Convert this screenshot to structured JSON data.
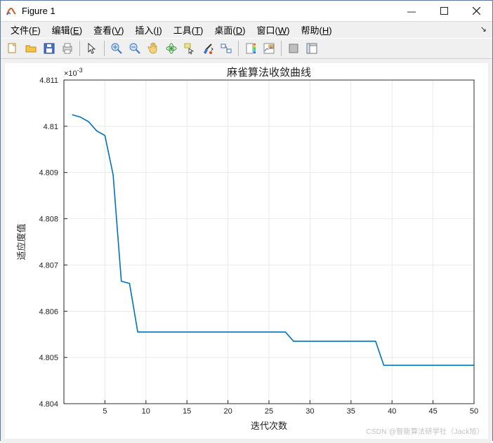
{
  "window": {
    "title": "Figure 1",
    "icon_name": "matlab-figure-icon",
    "buttons": {
      "min": "—",
      "max": "▢",
      "close": "✕"
    }
  },
  "menubar": {
    "items": [
      {
        "label": "文件",
        "mnemonic": "F"
      },
      {
        "label": "编辑",
        "mnemonic": "E"
      },
      {
        "label": "查看",
        "mnemonic": "V"
      },
      {
        "label": "插入",
        "mnemonic": "I"
      },
      {
        "label": "工具",
        "mnemonic": "T"
      },
      {
        "label": "桌面",
        "mnemonic": "D"
      },
      {
        "label": "窗口",
        "mnemonic": "W"
      },
      {
        "label": "帮助",
        "mnemonic": "H"
      }
    ],
    "overflow": "↘"
  },
  "toolbar": {
    "new": "new-figure-icon",
    "open": "open-folder-icon",
    "save": "save-icon",
    "print": "print-icon",
    "pointer": "pointer-icon",
    "zoom_in": "zoom-in-icon",
    "zoom_out": "zoom-out-icon",
    "pan": "pan-hand-icon",
    "rotate3d": "rotate-3d-icon",
    "datacursor": "data-cursor-icon",
    "brush": "brush-icon",
    "link": "link-plot-icon",
    "colorbar": "colorbar-icon",
    "legend": "legend-icon",
    "hide_tools": "hide-plot-tools-icon",
    "show_tools": "show-plot-tools-icon"
  },
  "chart_data": {
    "type": "line",
    "title": "麻雀算法收敛曲线",
    "xlabel": "迭代次数",
    "ylabel": "适应度值",
    "y_scale_text": "×10",
    "y_scale_exp": "-3",
    "xlim": [
      0,
      50
    ],
    "ylim": [
      4.804,
      4.811
    ],
    "xticks": [
      5,
      10,
      15,
      20,
      25,
      30,
      35,
      40,
      45,
      50
    ],
    "yticks": [
      4.804,
      4.805,
      4.806,
      4.807,
      4.808,
      4.809,
      4.81,
      4.811
    ],
    "ytick_labels": [
      "4.804",
      "4.805",
      "4.806",
      "4.807",
      "4.808",
      "4.809",
      "4.81",
      "4.811"
    ],
    "x": [
      1,
      2,
      3,
      4,
      5,
      6,
      7,
      8,
      9,
      10,
      11,
      12,
      13,
      14,
      15,
      16,
      17,
      18,
      19,
      20,
      21,
      22,
      23,
      24,
      25,
      26,
      27,
      28,
      29,
      30,
      31,
      32,
      33,
      34,
      35,
      36,
      37,
      38,
      39,
      40,
      41,
      42,
      43,
      44,
      45,
      46,
      47,
      48,
      49,
      50
    ],
    "y": [
      4.81025,
      4.8102,
      4.8101,
      4.8099,
      4.8098,
      4.80895,
      4.80665,
      4.8066,
      4.80555,
      4.80555,
      4.80555,
      4.80555,
      4.80555,
      4.80555,
      4.80555,
      4.80555,
      4.80555,
      4.80555,
      4.80555,
      4.80555,
      4.80555,
      4.80555,
      4.80555,
      4.80555,
      4.80555,
      4.80555,
      4.80555,
      4.80535,
      4.80535,
      4.80535,
      4.80535,
      4.80535,
      4.80535,
      4.80535,
      4.80535,
      4.80535,
      4.80535,
      4.80535,
      4.80483,
      4.80483,
      4.80483,
      4.80483,
      4.80483,
      4.80483,
      4.80483,
      4.80483,
      4.80483,
      4.80483,
      4.80483,
      4.80483
    ],
    "line_color": "#0072bd"
  },
  "watermark": "CSDN @智能算法研学社（Jack旭）"
}
